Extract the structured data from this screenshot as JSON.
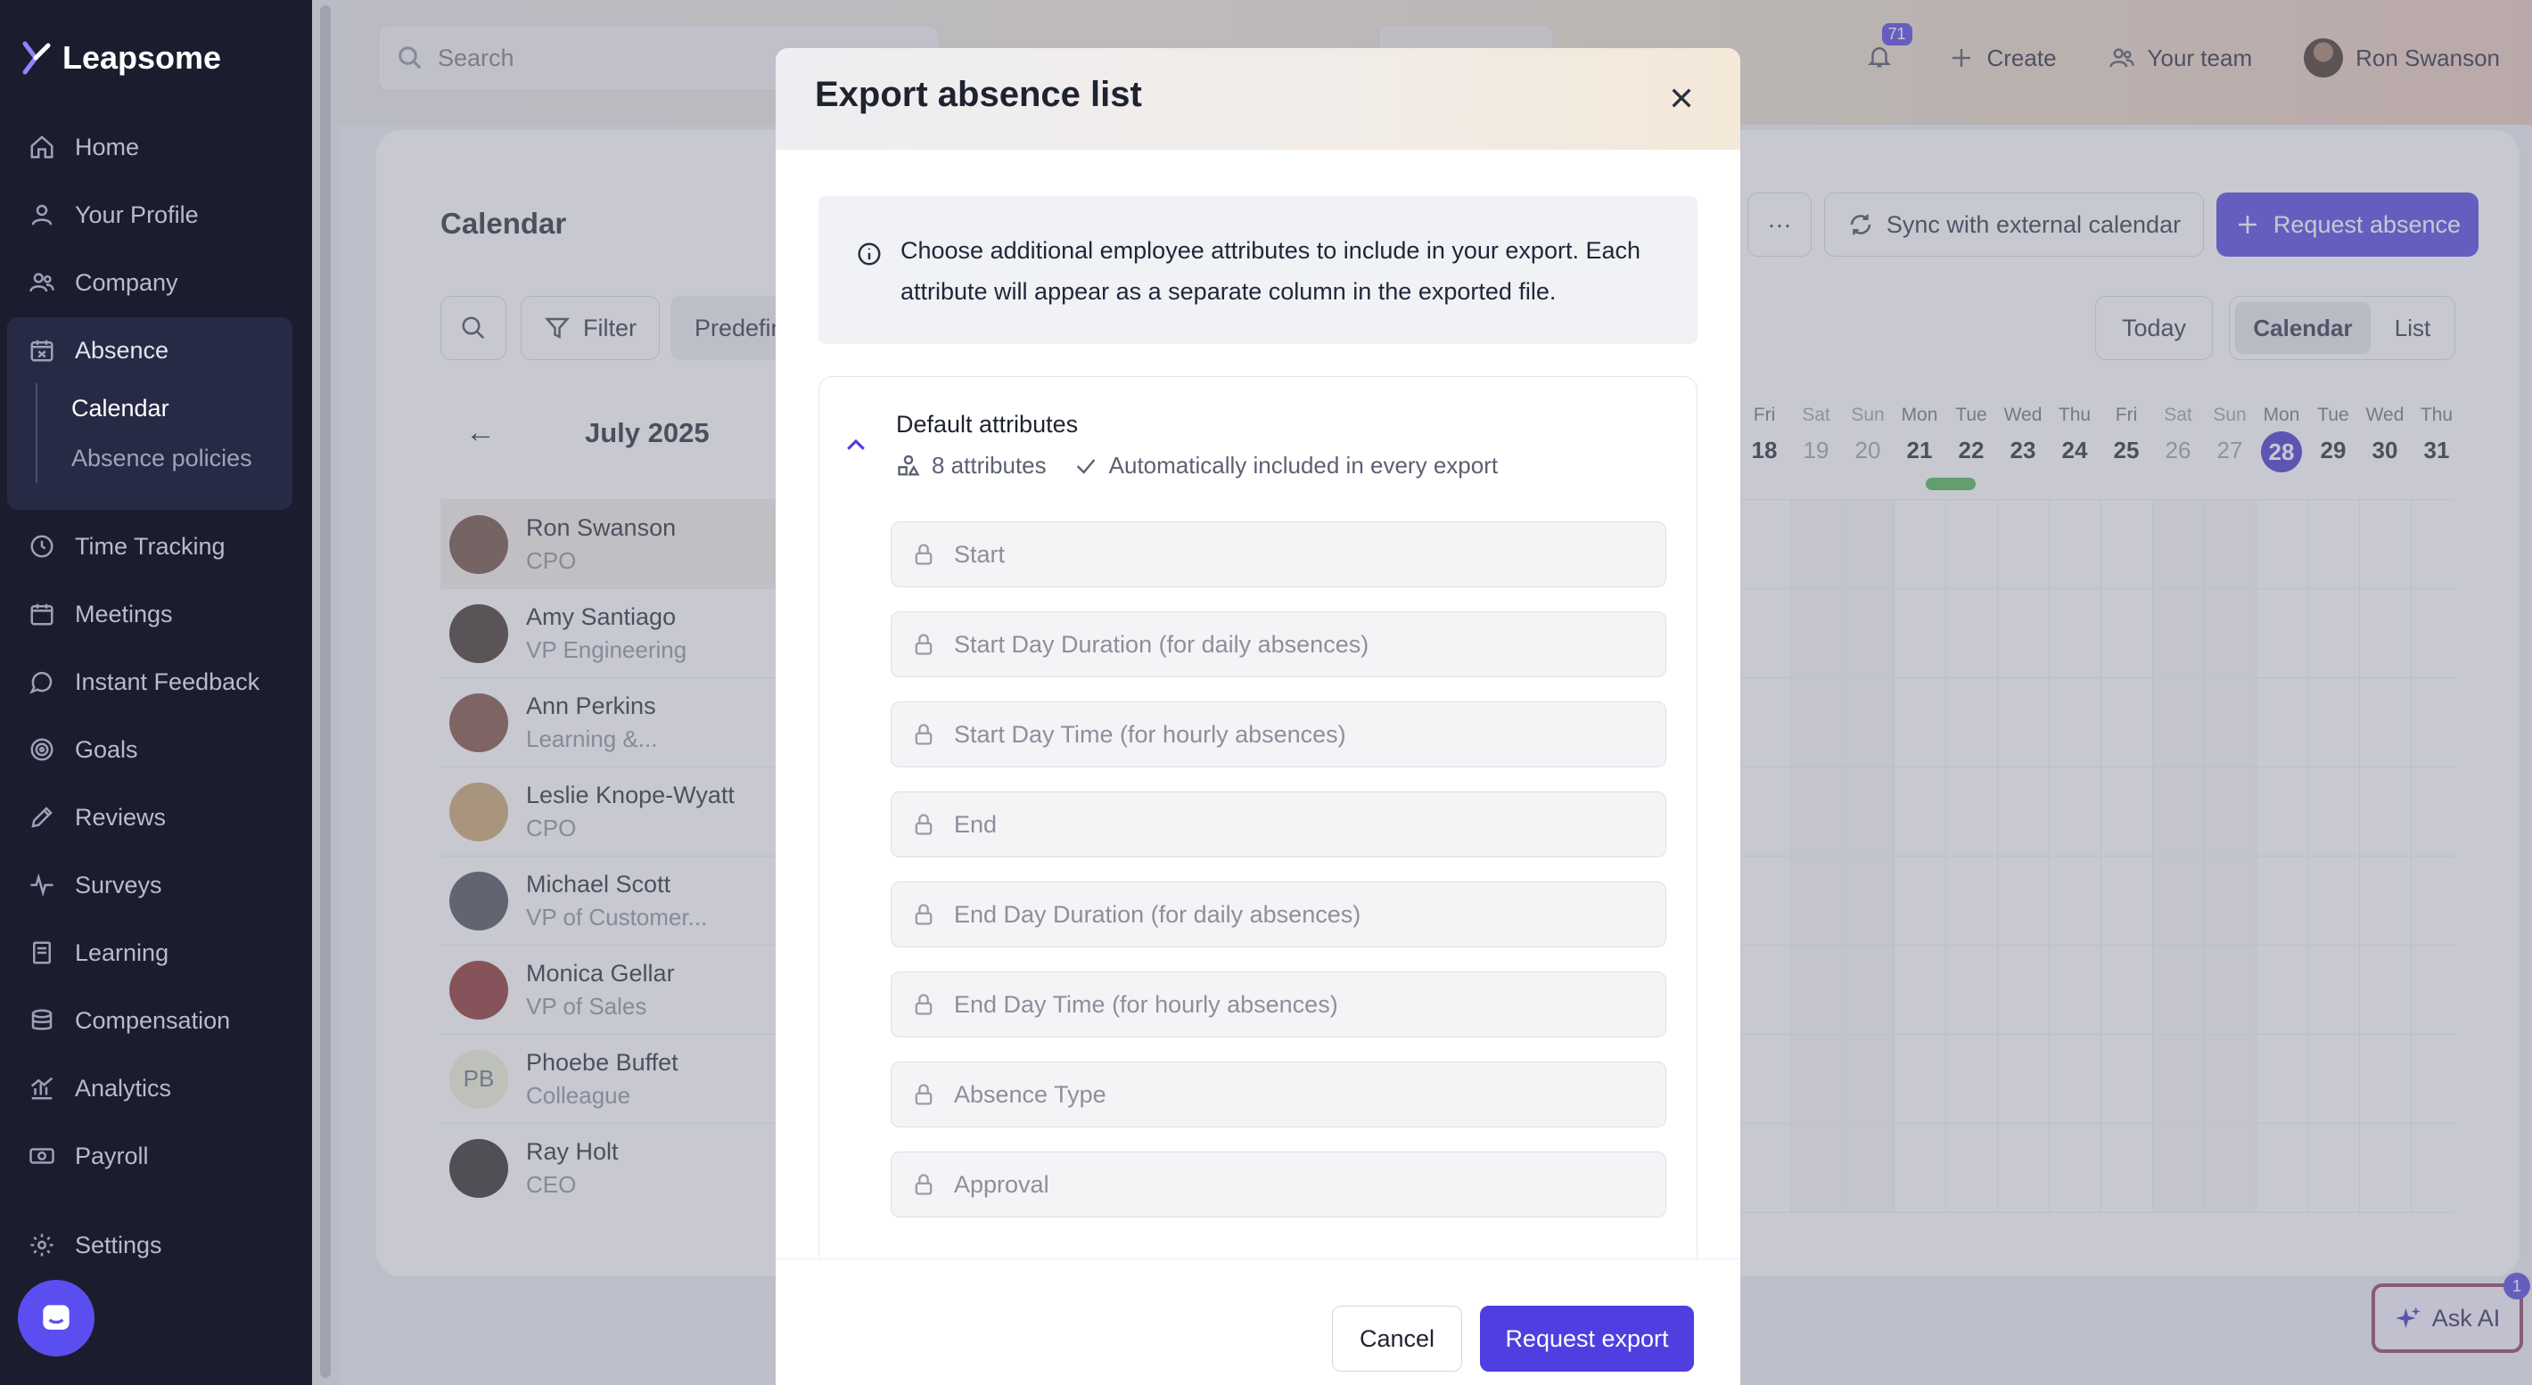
{
  "app": {
    "name": "Leapsome"
  },
  "sidebar": {
    "items": [
      {
        "label": "Home",
        "icon": "home-icon"
      },
      {
        "label": "Your Profile",
        "icon": "user-icon"
      },
      {
        "label": "Company",
        "icon": "users-icon"
      },
      {
        "label": "Absence",
        "icon": "calendar-x-icon"
      },
      {
        "label": "Time Tracking",
        "icon": "clock-icon"
      },
      {
        "label": "Meetings",
        "icon": "calendar-icon"
      },
      {
        "label": "Instant Feedback",
        "icon": "chat-icon"
      },
      {
        "label": "Goals",
        "icon": "target-icon"
      },
      {
        "label": "Reviews",
        "icon": "pencil-icon"
      },
      {
        "label": "Surveys",
        "icon": "pulse-icon"
      },
      {
        "label": "Learning",
        "icon": "book-icon"
      },
      {
        "label": "Compensation",
        "icon": "coins-icon"
      },
      {
        "label": "Analytics",
        "icon": "chart-icon"
      },
      {
        "label": "Payroll",
        "icon": "cash-icon"
      },
      {
        "label": "Settings",
        "icon": "gear-icon"
      }
    ],
    "absence_sub": [
      {
        "label": "Calendar"
      },
      {
        "label": "Absence policies"
      }
    ]
  },
  "topbar": {
    "search_placeholder": "Search",
    "notifications_count": "71",
    "create_label": "Create",
    "team_label": "Your team",
    "user_name": "Ron Swanson"
  },
  "calendar": {
    "title": "Calendar",
    "filter_label": "Filter",
    "predefined_label": "Predefin",
    "more_label": "···",
    "sync_label": "Sync with external calendar",
    "request_label": "Request absence",
    "today_label": "Today",
    "view_calendar": "Calendar",
    "view_list": "List",
    "month_label": "July 2025",
    "prev_arrow": "←",
    "days": [
      {
        "dow": "Fri",
        "num": "18",
        "weekend": false
      },
      {
        "dow": "Sat",
        "num": "19",
        "weekend": true
      },
      {
        "dow": "Sun",
        "num": "20",
        "weekend": true
      },
      {
        "dow": "Mon",
        "num": "21",
        "weekend": false
      },
      {
        "dow": "Tue",
        "num": "22",
        "weekend": false
      },
      {
        "dow": "Wed",
        "num": "23",
        "weekend": false
      },
      {
        "dow": "Thu",
        "num": "24",
        "weekend": false
      },
      {
        "dow": "Fri",
        "num": "25",
        "weekend": false
      },
      {
        "dow": "Sat",
        "num": "26",
        "weekend": true
      },
      {
        "dow": "Sun",
        "num": "27",
        "weekend": true
      },
      {
        "dow": "Mon",
        "num": "28",
        "weekend": false,
        "today": true
      },
      {
        "dow": "Tue",
        "num": "29",
        "weekend": false
      },
      {
        "dow": "Wed",
        "num": "30",
        "weekend": false
      },
      {
        "dow": "Thu",
        "num": "31",
        "weekend": false
      }
    ],
    "employees": [
      {
        "name": "Ron Swanson",
        "role": "CPO",
        "initials": "",
        "photo": "#6b4a3a"
      },
      {
        "name": "Amy Santiago",
        "role": "VP Engineering",
        "initials": "",
        "photo": "#3a2a25"
      },
      {
        "name": "Ann Perkins",
        "role": "Learning &...",
        "initials": "",
        "photo": "#7a4a3a"
      },
      {
        "name": "Leslie Knope-Wyatt",
        "role": "CPO",
        "initials": "",
        "photo": "#c9a36a"
      },
      {
        "name": "Michael Scott",
        "role": "VP of Customer...",
        "initials": "",
        "photo": "#4a4a55"
      },
      {
        "name": "Monica Gellar",
        "role": "VP of Sales",
        "initials": "",
        "photo": "#8a2a2a"
      },
      {
        "name": "Phoebe Buffet",
        "role": "Colleague",
        "initials": "PB",
        "photo": "#eef0d8"
      },
      {
        "name": "Ray Holt",
        "role": "CEO",
        "initials": "",
        "photo": "#2a2220"
      }
    ]
  },
  "ask_ai": {
    "label": "Ask AI",
    "badge": "1"
  },
  "modal": {
    "title": "Export absence list",
    "info": "Choose additional employee attributes to include in your export. Each attribute will appear as a separate column in the exported file.",
    "section_title": "Default attributes",
    "attr_count": "8 attributes",
    "auto_included": "Automatically included in every export",
    "fields": [
      "Start",
      "Start Day Duration (for daily absences)",
      "Start Day Time (for hourly absences)",
      "End",
      "End Day Duration (for daily absences)",
      "End Day Time (for hourly absences)",
      "Absence Type",
      "Approval"
    ],
    "cancel_label": "Cancel",
    "export_label": "Request export"
  },
  "colors": {
    "accent": "#4f3fe0",
    "sidebar_bg": "#1b1d2e",
    "absence_bar": "#4ab54a"
  }
}
